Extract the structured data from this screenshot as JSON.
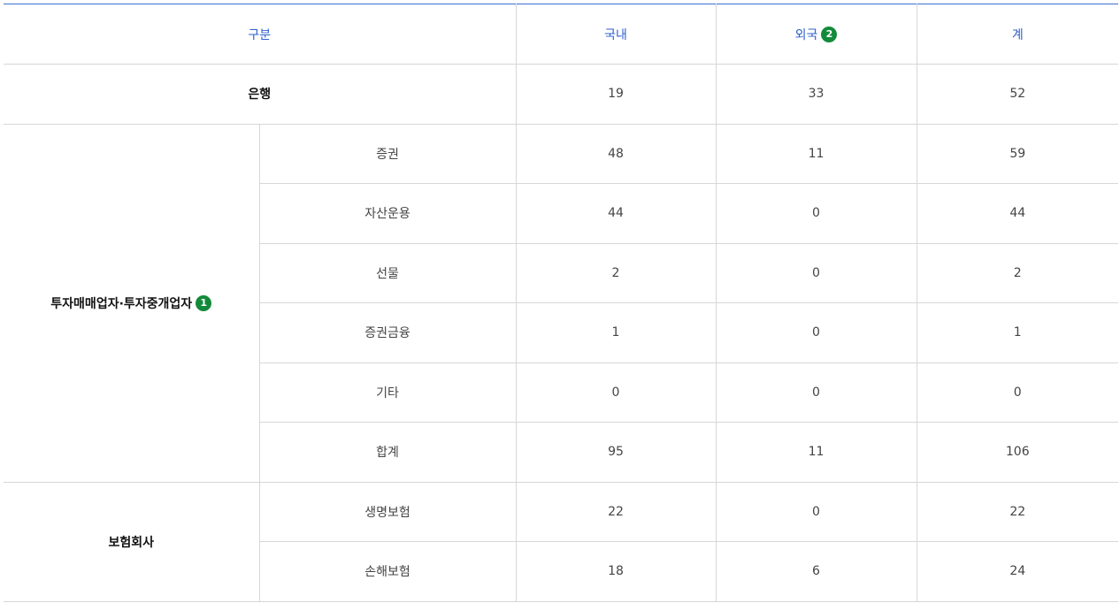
{
  "table": {
    "headers": {
      "category": "구분",
      "domestic": "국내",
      "foreign": "외국",
      "foreign_badge": "2",
      "total": "계"
    },
    "bank": {
      "label": "은행",
      "domestic": "19",
      "foreign": "33",
      "total": "52"
    },
    "investment": {
      "label": "투자매매업자·투자중개업자",
      "badge": "1",
      "rows": [
        {
          "label": "증권",
          "domestic": "48",
          "foreign": "11",
          "total": "59"
        },
        {
          "label": "자산운용",
          "domestic": "44",
          "foreign": "0",
          "total": "44"
        },
        {
          "label": "선물",
          "domestic": "2",
          "foreign": "0",
          "total": "2"
        },
        {
          "label": "증권금융",
          "domestic": "1",
          "foreign": "0",
          "total": "1"
        },
        {
          "label": "기타",
          "domestic": "0",
          "foreign": "0",
          "total": "0"
        },
        {
          "label": "합계",
          "domestic": "95",
          "foreign": "11",
          "total": "106"
        }
      ]
    },
    "insurance": {
      "label": "보험회사",
      "rows": [
        {
          "label": "생명보험",
          "domestic": "22",
          "foreign": "0",
          "total": "22"
        },
        {
          "label": "손해보험",
          "domestic": "18",
          "foreign": "6",
          "total": "24"
        }
      ]
    }
  }
}
